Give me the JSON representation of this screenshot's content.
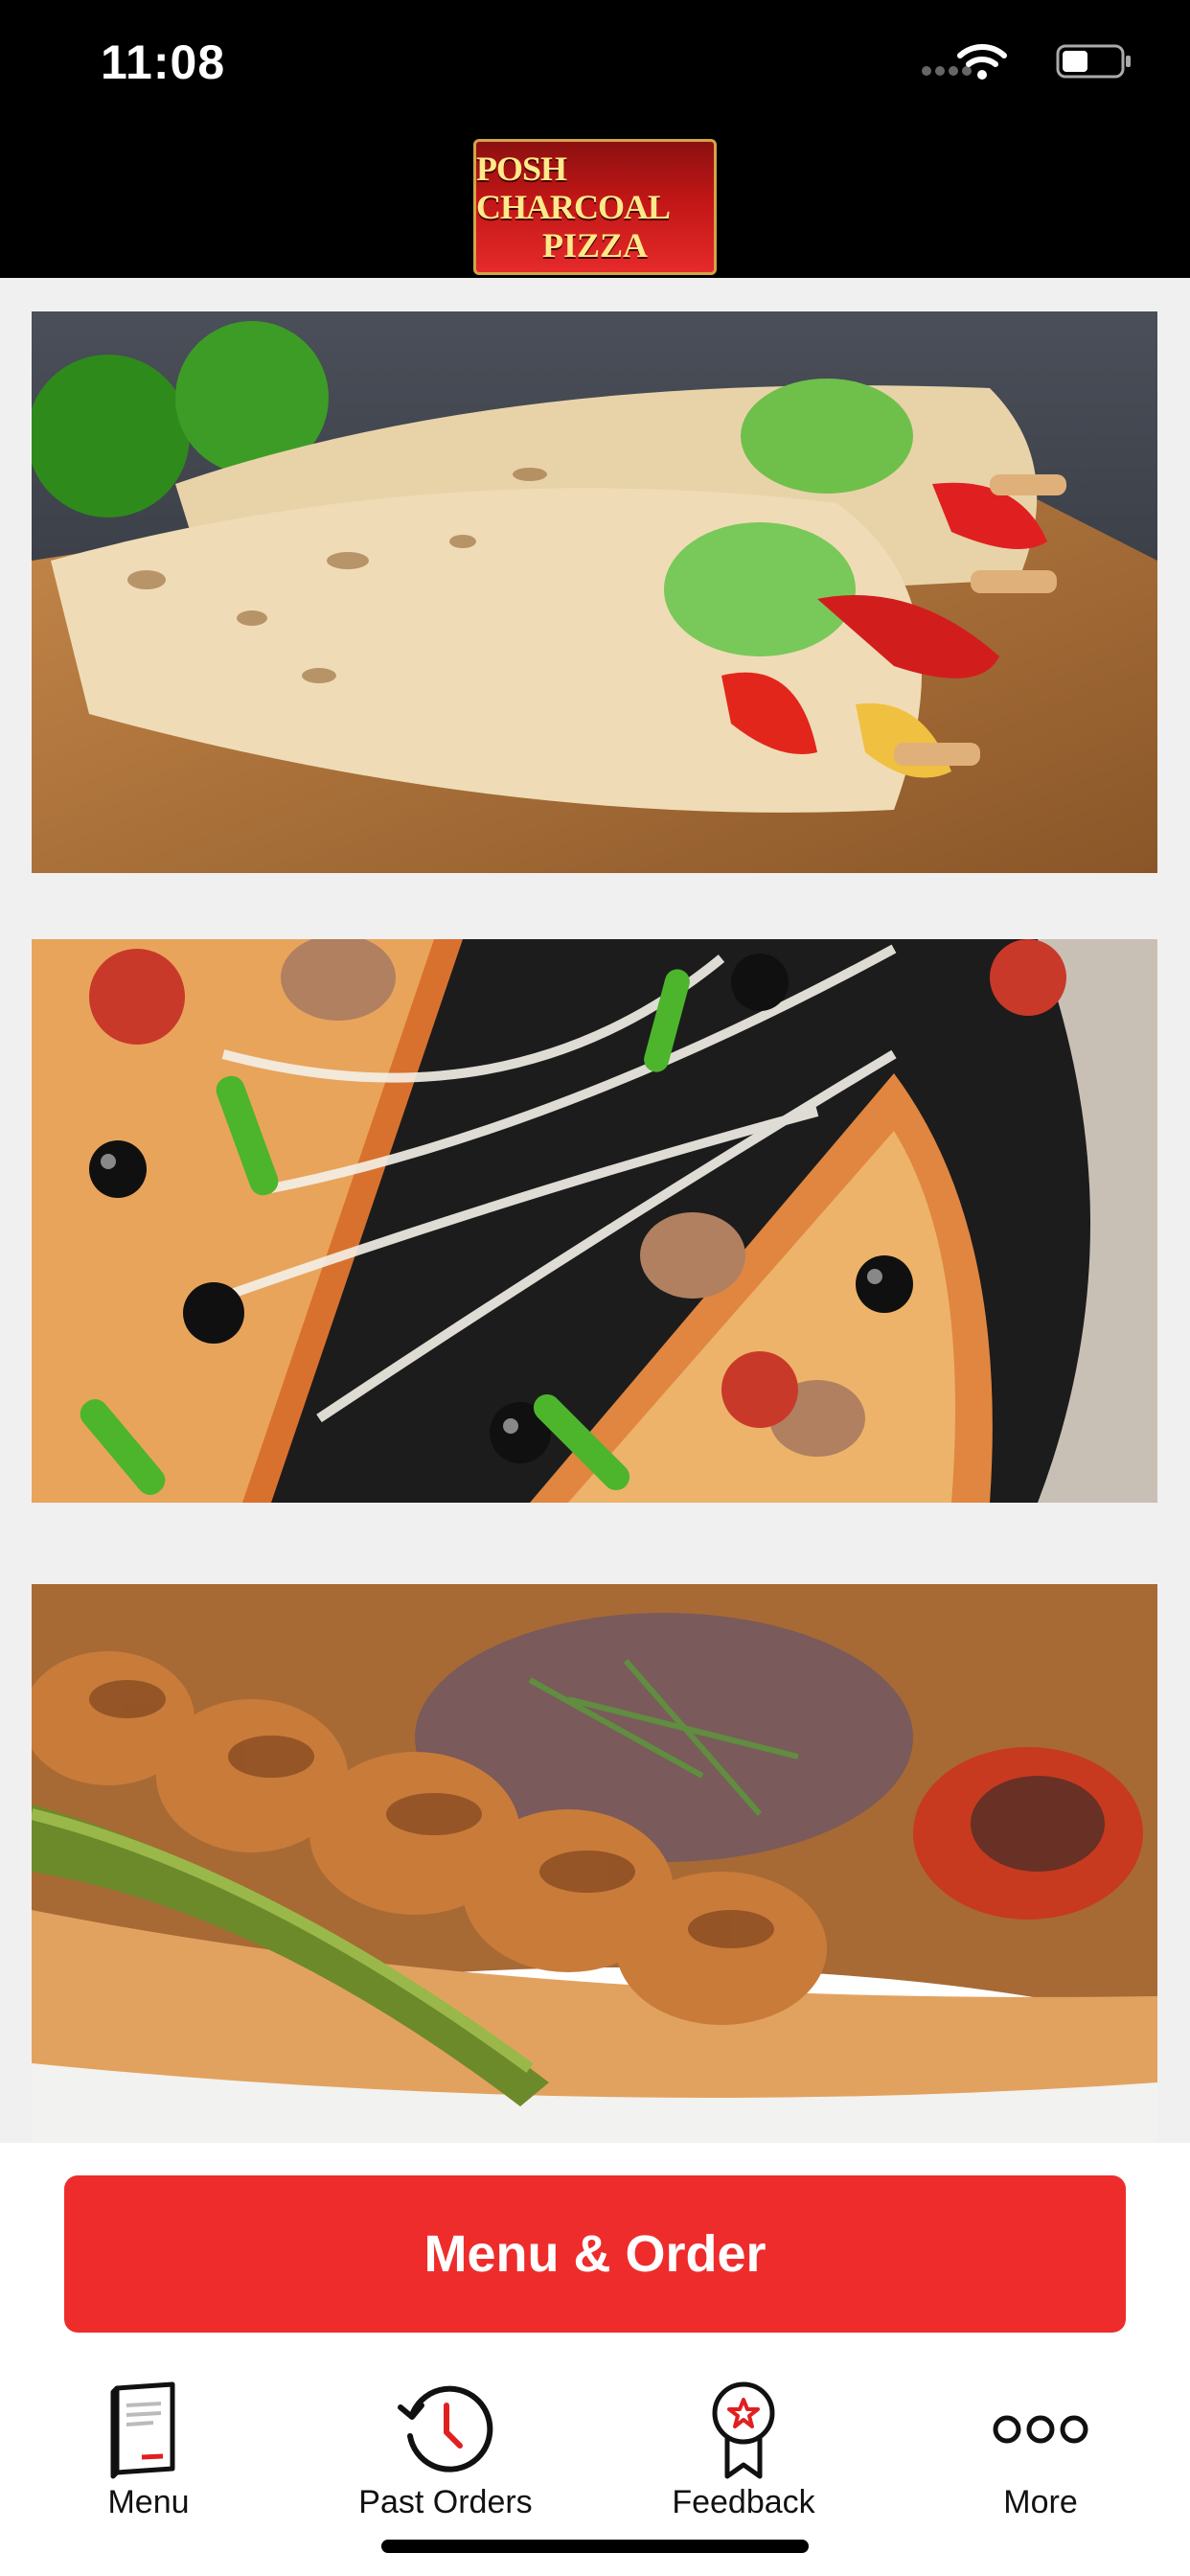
{
  "status_bar": {
    "time": "11:08",
    "icons": [
      "cellular-signal-icon",
      "wifi-icon",
      "battery-icon"
    ]
  },
  "header": {
    "logo_line1": "POSH CHARCOAL",
    "logo_line2": "PIZZA"
  },
  "images": [
    {
      "name": "chicken-wrap-image"
    },
    {
      "name": "pizza-image"
    },
    {
      "name": "chicken-kebab-image"
    }
  ],
  "primary_action": {
    "label": "Menu & Order",
    "color": "#ee2c2c"
  },
  "tab_bar": {
    "items": [
      {
        "label": "Menu",
        "icon": "menu-book-icon"
      },
      {
        "label": "Past Orders",
        "icon": "history-clock-icon"
      },
      {
        "label": "Feedback",
        "icon": "award-badge-icon"
      },
      {
        "label": "More",
        "icon": "more-dots-icon"
      }
    ]
  },
  "colors": {
    "header_bg": "#000000",
    "accent": "#ee2c2c",
    "page_bg": "#f0f0f0"
  }
}
